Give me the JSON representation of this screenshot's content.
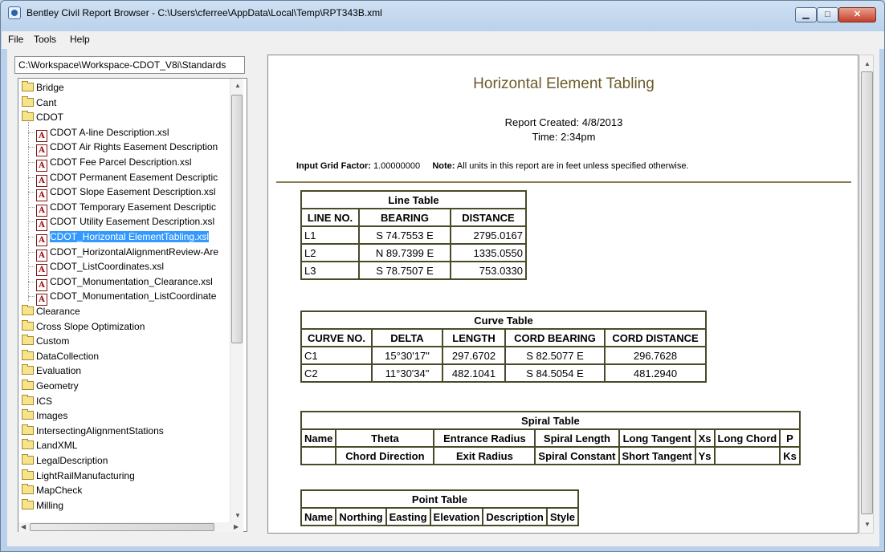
{
  "window": {
    "title": "Bentley Civil Report Browser - C:\\Users\\cferree\\AppData\\Local\\Temp\\RPT343B.xml",
    "controls": {
      "minimize": "▁",
      "maximize": "□",
      "close": "✕"
    }
  },
  "menu": {
    "items": [
      "File",
      "Tools",
      "Help"
    ]
  },
  "path": "C:\\Workspace\\Workspace-CDOT_V8i\\Standards",
  "tree": {
    "items": [
      {
        "label": "Bridge",
        "type": "folder",
        "level": 0
      },
      {
        "label": "Cant",
        "type": "folder",
        "level": 0
      },
      {
        "label": "CDOT",
        "type": "folder-open",
        "level": 0
      },
      {
        "label": "CDOT A-line Description.xsl",
        "type": "xsl",
        "level": 1
      },
      {
        "label": "CDOT Air Rights Easement Description",
        "type": "xsl",
        "level": 1
      },
      {
        "label": "CDOT Fee Parcel Description.xsl",
        "type": "xsl",
        "level": 1
      },
      {
        "label": "CDOT Permanent Easement Descriptic",
        "type": "xsl",
        "level": 1
      },
      {
        "label": "CDOT Slope Easement Description.xsl",
        "type": "xsl",
        "level": 1
      },
      {
        "label": "CDOT Temporary Easement Descriptic",
        "type": "xsl",
        "level": 1
      },
      {
        "label": "CDOT Utility Easement Description.xsl",
        "type": "xsl",
        "level": 1
      },
      {
        "label": "CDOT_Horizontal ElementTabling.xsl",
        "type": "xsl",
        "level": 1,
        "selected": true
      },
      {
        "label": "CDOT_HorizontalAlignmentReview-Are",
        "type": "xsl",
        "level": 1
      },
      {
        "label": "CDOT_ListCoordinates.xsl",
        "type": "xsl",
        "level": 1
      },
      {
        "label": "CDOT_Monumentation_Clearance.xsl",
        "type": "xsl",
        "level": 1
      },
      {
        "label": "CDOT_Monumentation_ListCoordinate",
        "type": "xsl",
        "level": 1
      },
      {
        "label": "Clearance",
        "type": "folder",
        "level": 0
      },
      {
        "label": "Cross Slope Optimization",
        "type": "folder",
        "level": 0
      },
      {
        "label": "Custom",
        "type": "folder",
        "level": 0
      },
      {
        "label": "DataCollection",
        "type": "folder",
        "level": 0
      },
      {
        "label": "Evaluation",
        "type": "folder",
        "level": 0
      },
      {
        "label": "Geometry",
        "type": "folder",
        "level": 0
      },
      {
        "label": "ICS",
        "type": "folder",
        "level": 0
      },
      {
        "label": "Images",
        "type": "folder",
        "level": 0
      },
      {
        "label": "IntersectingAlignmentStations",
        "type": "folder",
        "level": 0
      },
      {
        "label": "LandXML",
        "type": "folder",
        "level": 0
      },
      {
        "label": "LegalDescription",
        "type": "folder",
        "level": 0
      },
      {
        "label": "LightRailManufacturing",
        "type": "folder",
        "level": 0
      },
      {
        "label": "MapCheck",
        "type": "folder",
        "level": 0
      },
      {
        "label": "Milling",
        "type": "folder",
        "level": 0
      }
    ]
  },
  "report": {
    "title": "Horizontal Element Tabling",
    "created": "Report Created:  4/8/2013",
    "time": "Time:  2:34pm",
    "grid_factor_label": "Input Grid Factor:",
    "grid_factor_value": "1.00000000",
    "note_label": "Note:",
    "note_text": "All units in this report are in feet unless specified otherwise.",
    "line_table": {
      "title": "Line Table",
      "headers": [
        "LINE NO.",
        "BEARING",
        "DISTANCE"
      ],
      "rows": [
        [
          "L1",
          "S 74.7553 E",
          "2795.0167"
        ],
        [
          "L2",
          "N 89.7399 E",
          "1335.0550"
        ],
        [
          "L3",
          "S 78.7507 E",
          "753.0330"
        ]
      ]
    },
    "curve_table": {
      "title": "Curve Table",
      "headers": [
        "CURVE NO.",
        "DELTA",
        "LENGTH",
        "CORD BEARING",
        "CORD DISTANCE"
      ],
      "rows": [
        [
          "C1",
          "15°30'17\"",
          "297.6702",
          "S 82.5077 E",
          "296.7628"
        ],
        [
          "C2",
          "11°30'34\"",
          "482.1041",
          "S 84.5054 E",
          "481.2940"
        ]
      ]
    },
    "spiral_table": {
      "title": "Spiral Table",
      "row1": [
        "Name",
        "Theta",
        "Entrance Radius",
        "Spiral Length",
        "Long Tangent",
        "Xs",
        "Long Chord",
        "P"
      ],
      "row2": [
        "",
        "Chord Direction",
        "Exit Radius",
        "Spiral Constant",
        "Short Tangent",
        "Ys",
        "",
        "Ks"
      ]
    },
    "point_table": {
      "title": "Point Table",
      "headers": [
        "Name",
        "Northing",
        "Easting",
        "Elevation",
        "Description",
        "Style"
      ]
    }
  },
  "colors": {
    "title_brown": "#6b5b2b",
    "selection": "#3399ff",
    "table_border": "#4a4a28"
  }
}
